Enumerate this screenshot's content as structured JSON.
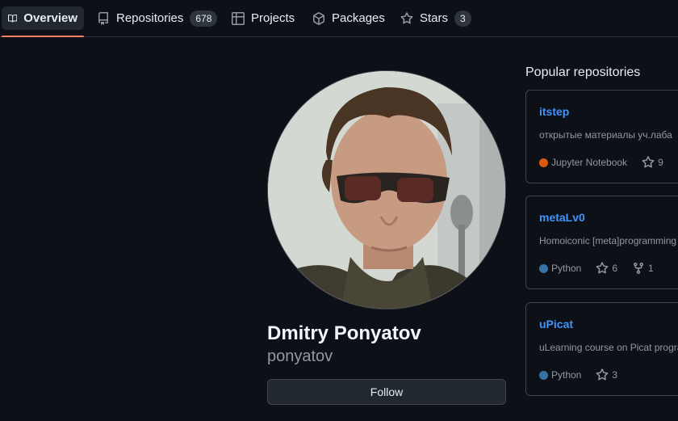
{
  "tabs": [
    {
      "label": "Overview",
      "icon": "book-icon",
      "active": true
    },
    {
      "label": "Repositories",
      "icon": "repo-icon",
      "count": "678"
    },
    {
      "label": "Projects",
      "icon": "table-icon"
    },
    {
      "label": "Packages",
      "icon": "package-icon"
    },
    {
      "label": "Stars",
      "icon": "star-icon",
      "count": "3"
    }
  ],
  "profile": {
    "name": "Dmitry Ponyatov",
    "login": "ponyatov",
    "follow_label": "Follow"
  },
  "popular": {
    "title": "Popular repositories",
    "repos": [
      {
        "name": "itstep",
        "description": "открытые материалы уч.лаба",
        "language": "Jupyter Notebook",
        "lang_color": "#DA5B0B",
        "stars": "9"
      },
      {
        "name": "metaLv0",
        "description": "Homoiconic [meta]programming",
        "language": "Python",
        "lang_color": "#3572A5",
        "stars": "6",
        "forks": "1"
      },
      {
        "name": "uPicat",
        "description": "uLearning course on Picat progra",
        "language": "Python",
        "lang_color": "#3572A5",
        "stars": "3"
      }
    ]
  },
  "colors": {
    "accent": "#f78166",
    "link": "#4493f8",
    "background": "#0d1117"
  }
}
